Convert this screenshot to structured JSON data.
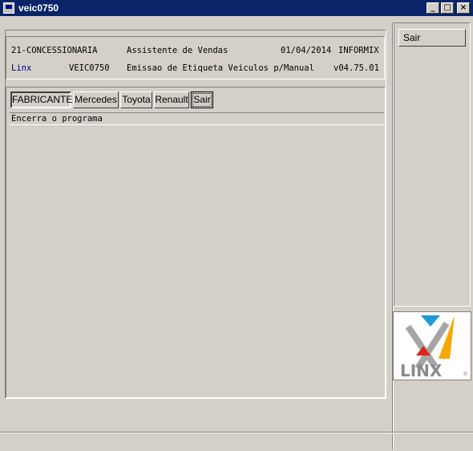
{
  "window": {
    "title": "veic0750",
    "minimize_label": "_",
    "maximize_label": "□",
    "close_label": "×"
  },
  "header": {
    "company": "21-CONCESSIONARIA",
    "module": "Assistente de Vendas",
    "date": "01/04/2014",
    "db": "INFORMIX",
    "brand": "Linx",
    "program": "VEIC0750",
    "description": "Emissao de Etiqueta Veiculos p/Manual",
    "version": "v04.75.01",
    "brand_color": "#000080"
  },
  "menu": {
    "items": [
      {
        "label": "FABRICANTE"
      },
      {
        "label": "Mercedes"
      },
      {
        "label": "Toyota"
      },
      {
        "label": "Renault"
      },
      {
        "label": "Sair"
      }
    ]
  },
  "status": {
    "text": "Encerra o programa"
  },
  "side": {
    "sair_label": "Sair"
  },
  "logo": {
    "text": "LINX",
    "registered": "®",
    "colors": [
      "#1e9ad6",
      "#f5a800",
      "#e2231a",
      "#8a8a8a"
    ]
  }
}
